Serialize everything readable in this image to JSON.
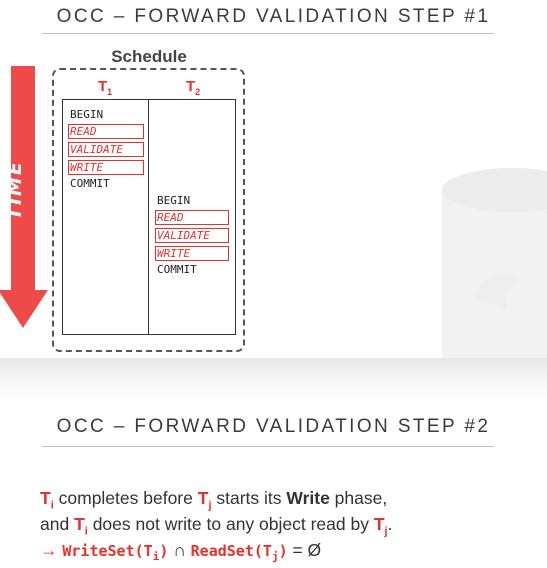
{
  "slide1": {
    "title": "OCC – FORWARD VALIDATION STEP #1",
    "schedule_label": "Schedule",
    "time_label": "TIME",
    "t1": {
      "name": "T",
      "sub": "1",
      "ops": [
        "BEGIN",
        "READ",
        "VALIDATE",
        "WRITE",
        "COMMIT"
      ]
    },
    "t2": {
      "name": "T",
      "sub": "2",
      "ops": [
        "BEGIN",
        "READ",
        "VALIDATE",
        "WRITE",
        "COMMIT"
      ]
    },
    "colors": {
      "accent": "#e8302b",
      "arrow": "#ef4a4a",
      "text": "#3b3b3b"
    }
  },
  "slide2": {
    "title": "OCC – FORWARD VALIDATION STEP #2",
    "line1": {
      "ti": "T",
      "ti_sub": "i",
      "a": " completes before ",
      "tj": "T",
      "tj_sub": "j",
      "b": " starts its ",
      "bold": "Write",
      "c": " phase,"
    },
    "line2": {
      "a": "and ",
      "ti": "T",
      "ti_sub": "i",
      "b": " does not write to any object read by ",
      "tj": "T",
      "tj_sub": "j",
      "c": "."
    },
    "line3": {
      "arrow": "→ ",
      "ws": "WriteSet(T",
      "ws_sub": "i",
      "ws_close": ")",
      "cap": " ∩ ",
      "rs": "ReadSet(T",
      "rs_sub": "j",
      "rs_close": ")",
      "eq": " = Ø"
    }
  }
}
